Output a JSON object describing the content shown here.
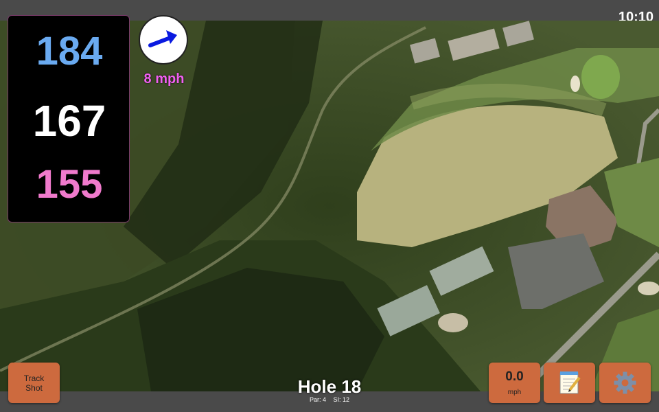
{
  "status": {
    "clock": "10:10"
  },
  "distances": {
    "back": {
      "value": "184",
      "color": "#6aaaf0"
    },
    "middle": {
      "value": "167",
      "color": "#ffffff"
    },
    "front": {
      "value": "155",
      "color": "#f07acc"
    }
  },
  "wind": {
    "speed_label": "8 mph",
    "arrow_icon": "wind-arrow-icon",
    "arrow_color": "#0a1ae0"
  },
  "buttons": {
    "track_shot": {
      "line1": "Track",
      "line2": "Shot"
    },
    "speed": {
      "value": "0.0",
      "unit": "mph"
    },
    "notes": {
      "icon": "notepad-icon"
    },
    "settings": {
      "icon": "gear-icon"
    }
  },
  "hole": {
    "title": "Hole 18",
    "par": "Par: 4",
    "si": "SI: 12"
  },
  "colors": {
    "button_bg": "#cd6a3e",
    "bar_bg": "#4a4a4a"
  }
}
